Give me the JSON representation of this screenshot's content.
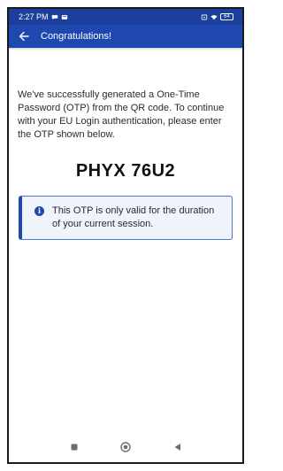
{
  "status_bar": {
    "time": "2:27 PM",
    "battery": "64"
  },
  "app_bar": {
    "title": "Congratulations!",
    "back_icon": "arrow-left-icon"
  },
  "content": {
    "intro": "We've successfully generated a One-Time Password (OTP) from the QR code. To continue with your EU Login authentication, please enter the OTP shown below.",
    "otp": "PHYX 76U2",
    "notice": {
      "icon": "info-icon",
      "icon_glyph": "i",
      "text": "This OTP is only valid for the duration of your current session."
    }
  },
  "nav_bar": {
    "recents_icon": "square-icon",
    "home_icon": "circle-icon",
    "back_icon": "triangle-back-icon"
  },
  "colors": {
    "status_bar": "#1c3f9e",
    "app_bar": "#1f47b0",
    "notice_background": "#eef3fc",
    "notice_border": "#4a79d6"
  }
}
